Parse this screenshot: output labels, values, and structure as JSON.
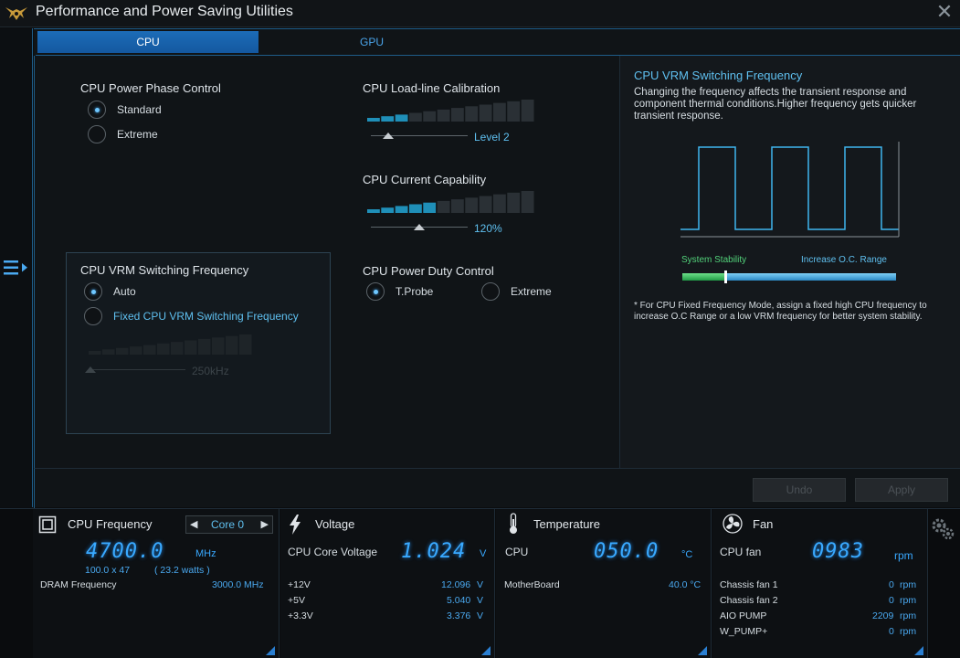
{
  "window": {
    "title": "Performance and Power Saving Utilities"
  },
  "tabs": [
    {
      "label": "CPU"
    },
    {
      "label": "GPU"
    }
  ],
  "phase_control": {
    "title": "CPU Power Phase Control",
    "options": [
      {
        "label": "Standard",
        "selected": true
      },
      {
        "label": "Extreme",
        "selected": false
      }
    ]
  },
  "load_line": {
    "title": "CPU Load-line Calibration",
    "value_label": "Level 2",
    "level_fraction": 0.22
  },
  "current_capability": {
    "title": "CPU Current Capability",
    "value_label": "120%",
    "level_fraction": 0.45
  },
  "vrm_switching": {
    "title": "CPU VRM Switching Frequency",
    "options": [
      {
        "label": "Auto",
        "selected": true
      },
      {
        "label": "Fixed CPU VRM Switching Frequency",
        "selected": false
      }
    ],
    "value_label": "250kHz"
  },
  "duty_control": {
    "title": "CPU Power Duty Control",
    "options": [
      {
        "label": "T.Probe",
        "selected": true
      },
      {
        "label": "Extreme",
        "selected": false
      }
    ]
  },
  "info_panel": {
    "title": "CPU VRM Switching Frequency",
    "description": "Changing the frequency affects the transient response and component thermal conditions.Higher frequency gets quicker transient response.",
    "left_label": "System Stability",
    "right_label": "Increase O.C. Range",
    "note": "* For CPU Fixed Frequency Mode, assign a fixed high CPU frequency to increase O.C Range or a low VRM frequency for better system stability."
  },
  "buttons": {
    "undo": "Undo",
    "apply": "Apply"
  },
  "monitor": {
    "cpu_freq": {
      "title": "CPU Frequency",
      "core_label": "Core 0",
      "value": "4700.0",
      "unit": "MHz",
      "ratio": "100.0  x  47",
      "watts": "( 23.2 watts )",
      "dram_label": "DRAM Frequency",
      "dram_value": "3000.0  MHz"
    },
    "voltage": {
      "title": "Voltage",
      "main_label": "CPU Core Voltage",
      "value": "1.024",
      "unit": "V",
      "rows": [
        {
          "label": "+12V",
          "value": "12.096",
          "unit": "V"
        },
        {
          "label": "+5V",
          "value": "5.040",
          "unit": "V"
        },
        {
          "label": "+3.3V",
          "value": "3.376",
          "unit": "V"
        }
      ]
    },
    "temperature": {
      "title": "Temperature",
      "main_label": "CPU",
      "value": "050.0",
      "unit": "°C",
      "rows": [
        {
          "label": "MotherBoard",
          "value": "40.0 °C"
        }
      ]
    },
    "fan": {
      "title": "Fan",
      "main_label": "CPU fan",
      "value": "0983",
      "unit": "rpm",
      "rows": [
        {
          "label": "Chassis fan 1",
          "value": "0",
          "unit": "rpm"
        },
        {
          "label": "Chassis fan 2",
          "value": "0",
          "unit": "rpm"
        },
        {
          "label": "AIO PUMP",
          "value": "2209",
          "unit": "rpm"
        },
        {
          "label": "W_PUMP+",
          "value": "0",
          "unit": "rpm"
        }
      ]
    }
  },
  "colors": {
    "accent": "#1c6cb8",
    "value_blue": "#39a9ff",
    "stability_green": "#2fbf5c"
  }
}
